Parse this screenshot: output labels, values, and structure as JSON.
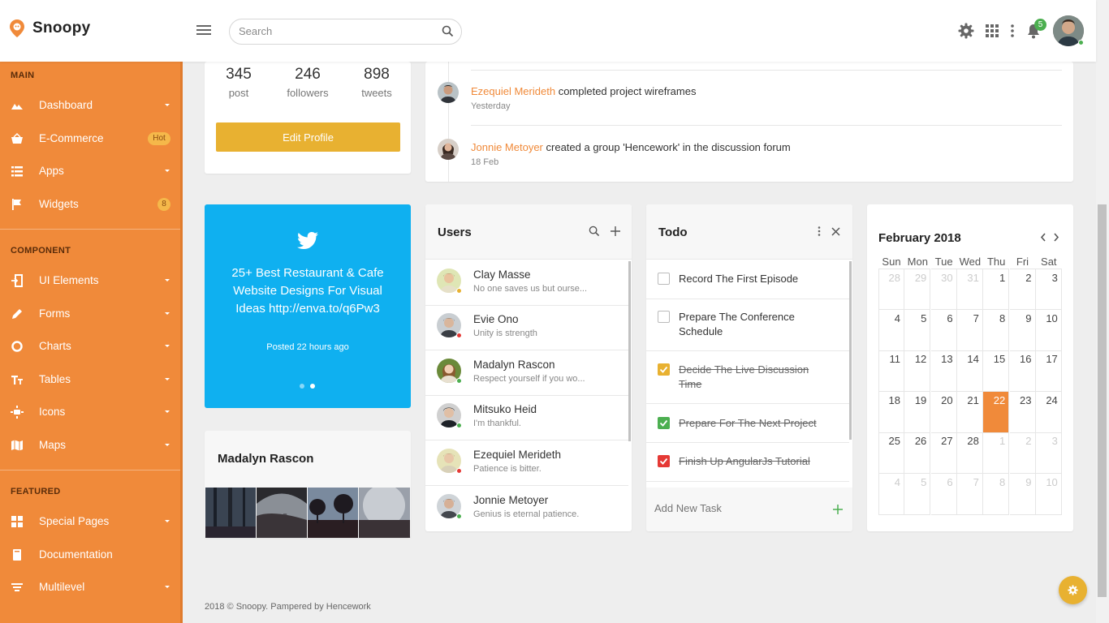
{
  "app": {
    "name": "Snoopy"
  },
  "search": {
    "placeholder": "Search"
  },
  "topbar": {
    "notification_count": "5"
  },
  "sidebar": {
    "sections": [
      "MAIN",
      "COMPONENT",
      "FEATURED"
    ],
    "main_items": [
      {
        "label": "Dashboard",
        "icon": "chart-icon"
      },
      {
        "label": "E-Commerce",
        "icon": "basket-icon",
        "badge": "Hot"
      },
      {
        "label": "Apps",
        "icon": "list-icon"
      },
      {
        "label": "Widgets",
        "icon": "flag-icon",
        "badge": "8"
      }
    ],
    "component_items": [
      {
        "label": "UI Elements",
        "icon": "login-icon"
      },
      {
        "label": "Forms",
        "icon": "pencil-icon"
      },
      {
        "label": "Charts",
        "icon": "donut-icon"
      },
      {
        "label": "Tables",
        "icon": "text-size-icon"
      },
      {
        "label": "Icons",
        "icon": "sun-icon"
      },
      {
        "label": "Maps",
        "icon": "map-icon"
      }
    ],
    "featured_items": [
      {
        "label": "Special Pages",
        "icon": "pages-icon"
      },
      {
        "label": "Documentation",
        "icon": "book-icon"
      },
      {
        "label": "Multilevel",
        "icon": "sort-icon"
      }
    ]
  },
  "profile": {
    "stats": [
      {
        "value": "345",
        "label": "post"
      },
      {
        "value": "246",
        "label": "followers"
      },
      {
        "value": "898",
        "label": "tweets"
      }
    ],
    "edit_label": "Edit Profile"
  },
  "activity": [
    {
      "who": "Ezequiel Merideth",
      "action": "completed project wireframes",
      "time": "Yesterday"
    },
    {
      "who": "Jonnie Metoyer",
      "action": "created a group 'Hencework' in the discussion forum",
      "time": "18 Feb"
    }
  ],
  "tweet": {
    "text": "25+ Best Restaurant & Cafe Website Designs For Visual Ideas http://enva.to/q6Pw3",
    "posted": "Posted 22 hours ago"
  },
  "gallery": {
    "title": "Madalyn Rascon"
  },
  "users": {
    "title": "Users",
    "list": [
      {
        "name": "Clay Masse",
        "message": "No one saves us but ourse...",
        "status": "away"
      },
      {
        "name": "Evie Ono",
        "message": "Unity is strength",
        "status": "busy"
      },
      {
        "name": "Madalyn Rascon",
        "message": "Respect yourself if you wo...",
        "status": "online"
      },
      {
        "name": "Mitsuko Heid",
        "message": "I'm thankful.",
        "status": "online"
      },
      {
        "name": "Ezequiel Merideth",
        "message": "Patience is bitter.",
        "status": "busy"
      },
      {
        "name": "Jonnie Metoyer",
        "message": "Genius is eternal patience.",
        "status": "online"
      }
    ]
  },
  "todo": {
    "title": "Todo",
    "items": [
      {
        "text": "Record The First Episode",
        "done": false
      },
      {
        "text": "Prepare The Conference Schedule",
        "done": false
      },
      {
        "text": "Decide The Live Discussion Time",
        "done": true,
        "color": "#e8b131"
      },
      {
        "text": "Prepare For The Next Project",
        "done": true,
        "color": "#4caf50"
      },
      {
        "text": "Finish Up AngularJs Tutorial",
        "done": true,
        "color": "#e53935"
      }
    ],
    "add_placeholder": "Add New Task"
  },
  "calendar": {
    "title": "February 2018",
    "days": [
      "Sun",
      "Mon",
      "Tue",
      "Wed",
      "Thu",
      "Fri",
      "Sat"
    ],
    "weeks": [
      [
        "28",
        "29",
        "30",
        "31",
        "1",
        "2",
        "3"
      ],
      [
        "4",
        "5",
        "6",
        "7",
        "8",
        "9",
        "10"
      ],
      [
        "11",
        "12",
        "13",
        "14",
        "15",
        "16",
        "17"
      ],
      [
        "18",
        "19",
        "20",
        "21",
        "22",
        "23",
        "24"
      ],
      [
        "25",
        "26",
        "27",
        "28",
        "1",
        "2",
        "3"
      ],
      [
        "4",
        "5",
        "6",
        "7",
        "8",
        "9",
        "10"
      ]
    ],
    "today": "22"
  },
  "footer": {
    "text": "2018 © Snoopy. Pampered by Hencework"
  },
  "colors": {
    "accent": "#f08a3a",
    "twitter": "#0fb0f0",
    "gold": "#e8b131",
    "online": "#4caf50",
    "busy": "#e53935",
    "away": "#e8b131"
  }
}
